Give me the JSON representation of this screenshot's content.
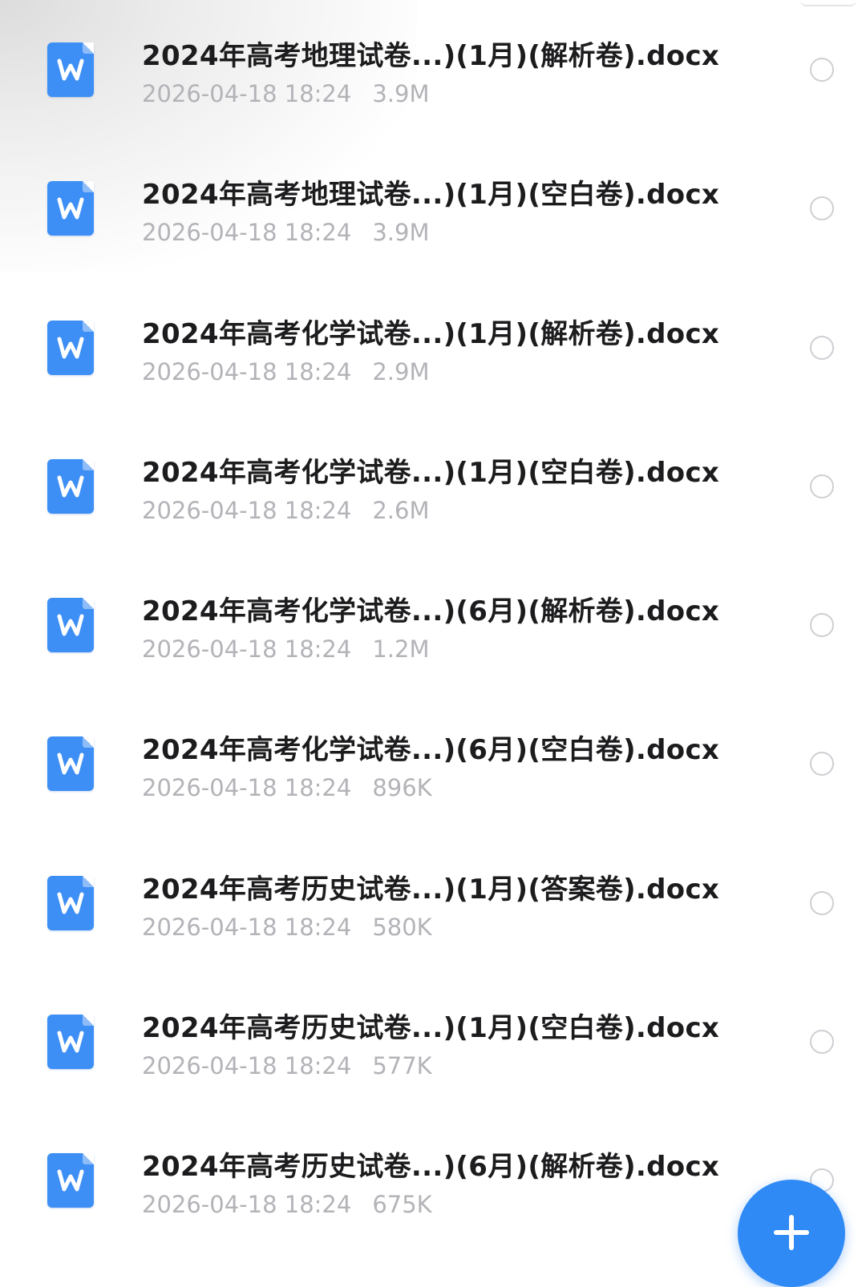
{
  "files": [
    {
      "name": "2024年高考地理试卷...)(1月)(解析卷).docx",
      "date": "2026-04-18 18:24",
      "size": "3.9M",
      "icon": "word-doc-icon",
      "selected": false
    },
    {
      "name": "2024年高考地理试卷...)(1月)(空白卷).docx",
      "date": "2026-04-18 18:24",
      "size": "3.9M",
      "icon": "word-doc-icon",
      "selected": false
    },
    {
      "name": "2024年高考化学试卷...)(1月)(解析卷).docx",
      "date": "2026-04-18 18:24",
      "size": "2.9M",
      "icon": "word-doc-icon",
      "selected": false
    },
    {
      "name": "2024年高考化学试卷...)(1月)(空白卷).docx",
      "date": "2026-04-18 18:24",
      "size": "2.6M",
      "icon": "word-doc-icon",
      "selected": false
    },
    {
      "name": "2024年高考化学试卷...)(6月)(解析卷).docx",
      "date": "2026-04-18 18:24",
      "size": "1.2M",
      "icon": "word-doc-icon",
      "selected": false
    },
    {
      "name": "2024年高考化学试卷...)(6月)(空白卷).docx",
      "date": "2026-04-18 18:24",
      "size": "896K",
      "icon": "word-doc-icon",
      "selected": false
    },
    {
      "name": "2024年高考历史试卷...)(1月)(答案卷).docx",
      "date": "2026-04-18 18:24",
      "size": "580K",
      "icon": "word-doc-icon",
      "selected": false
    },
    {
      "name": "2024年高考历史试卷...)(1月)(空白卷).docx",
      "date": "2026-04-18 18:24",
      "size": "577K",
      "icon": "word-doc-icon",
      "selected": false
    },
    {
      "name": "2024年高考历史试卷...)(6月)(解析卷).docx",
      "date": "2026-04-18 18:24",
      "size": "675K",
      "icon": "word-doc-icon",
      "selected": false
    }
  ],
  "fab": {
    "icon": "plus-icon"
  },
  "colors": {
    "accent": "#2f8af5",
    "word_icon": "#3d8ff5",
    "title_text": "#1c1c1e",
    "meta_text": "#b3b3b8",
    "radio_border": "#cfcfd4"
  }
}
